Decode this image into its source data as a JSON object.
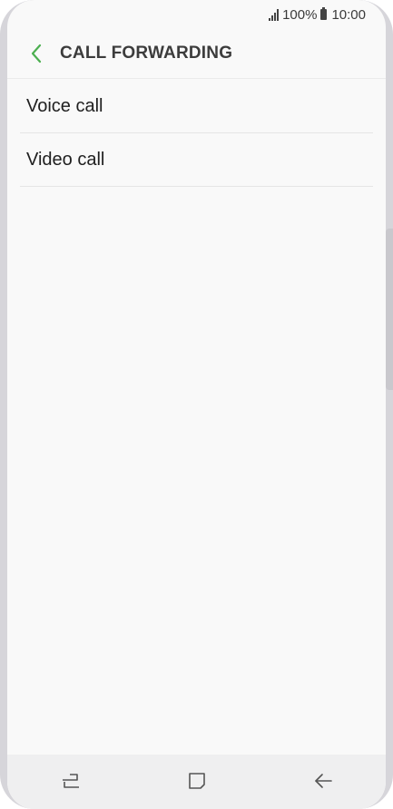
{
  "status_bar": {
    "battery": "100%",
    "time": "10:00",
    "icons": [
      "signal-icon",
      "battery-icon"
    ]
  },
  "header": {
    "title": "CALL FORWARDING",
    "back_icon": "chevron-left-icon"
  },
  "list": {
    "items": [
      {
        "label": "Voice call"
      },
      {
        "label": "Video call"
      }
    ]
  },
  "nav_bar": {
    "icons": [
      "recent-apps-icon",
      "home-icon",
      "back-arrow-icon"
    ]
  },
  "colors": {
    "accent": "#4caf50",
    "background": "#f9f9f9",
    "nav_background": "#efeff0",
    "frame": "#d6d5da"
  }
}
